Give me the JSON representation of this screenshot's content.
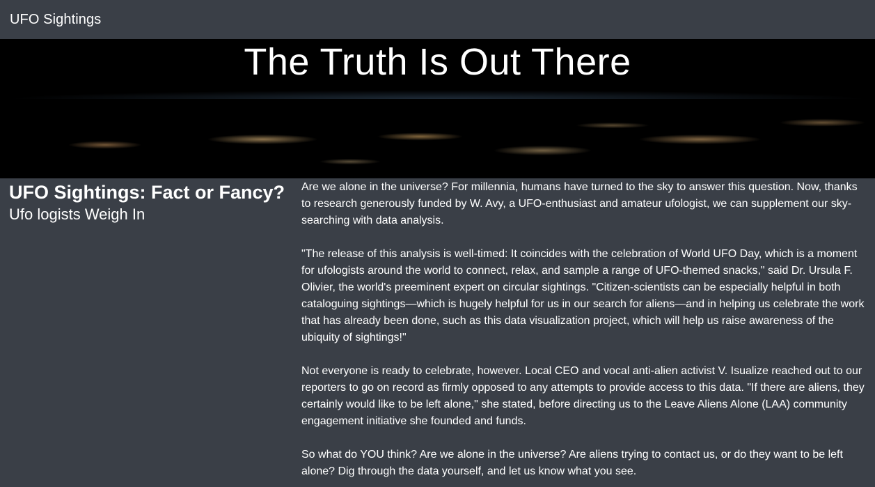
{
  "navbar": {
    "brand": "UFO Sightings"
  },
  "hero": {
    "title": "The Truth Is Out There"
  },
  "article": {
    "heading": "UFO Sightings: Fact or Fancy?",
    "subheading": "Ufo logists Weigh In",
    "paragraphs": [
      "Are we alone in the universe? For millennia, humans have turned to the sky to answer this question. Now, thanks to research generously funded by W. Avy, a UFO-enthusiast and amateur ufologist, we can supplement our sky-searching with data analysis.",
      "\"The release of this analysis is well-timed: It coincides with the celebration of World UFO Day, which is a moment for ufologists around the world to connect, relax, and sample a range of UFO-themed snacks,\" said Dr. Ursula F. Olivier, the world's preeminent expert on circular sightings. \"Citizen-scientists can be especially helpful in both cataloguing sightings—which is hugely helpful for us in our search for aliens—and in helping us celebrate the work that has already been done, such as this data visualization project, which will help us raise awareness of the ubiquity of sightings!\"",
      "Not everyone is ready to celebrate, however. Local CEO and vocal anti-alien activist V. Isualize reached out to our reporters to go on record as firmly opposed to any attempts to provide access to this data. \"If there are aliens, they certainly would like to be left alone,\" she stated, before directing us to the Leave Aliens Alone (LAA) community engagement initiative she founded and funds.",
      "So what do YOU think? Are we alone in the universe? Are aliens trying to contact us, or do they want to be left alone? Dig through the data yourself, and let us know what you see."
    ]
  },
  "colors": {
    "background": "#3a3f47",
    "text": "#ffffff"
  }
}
